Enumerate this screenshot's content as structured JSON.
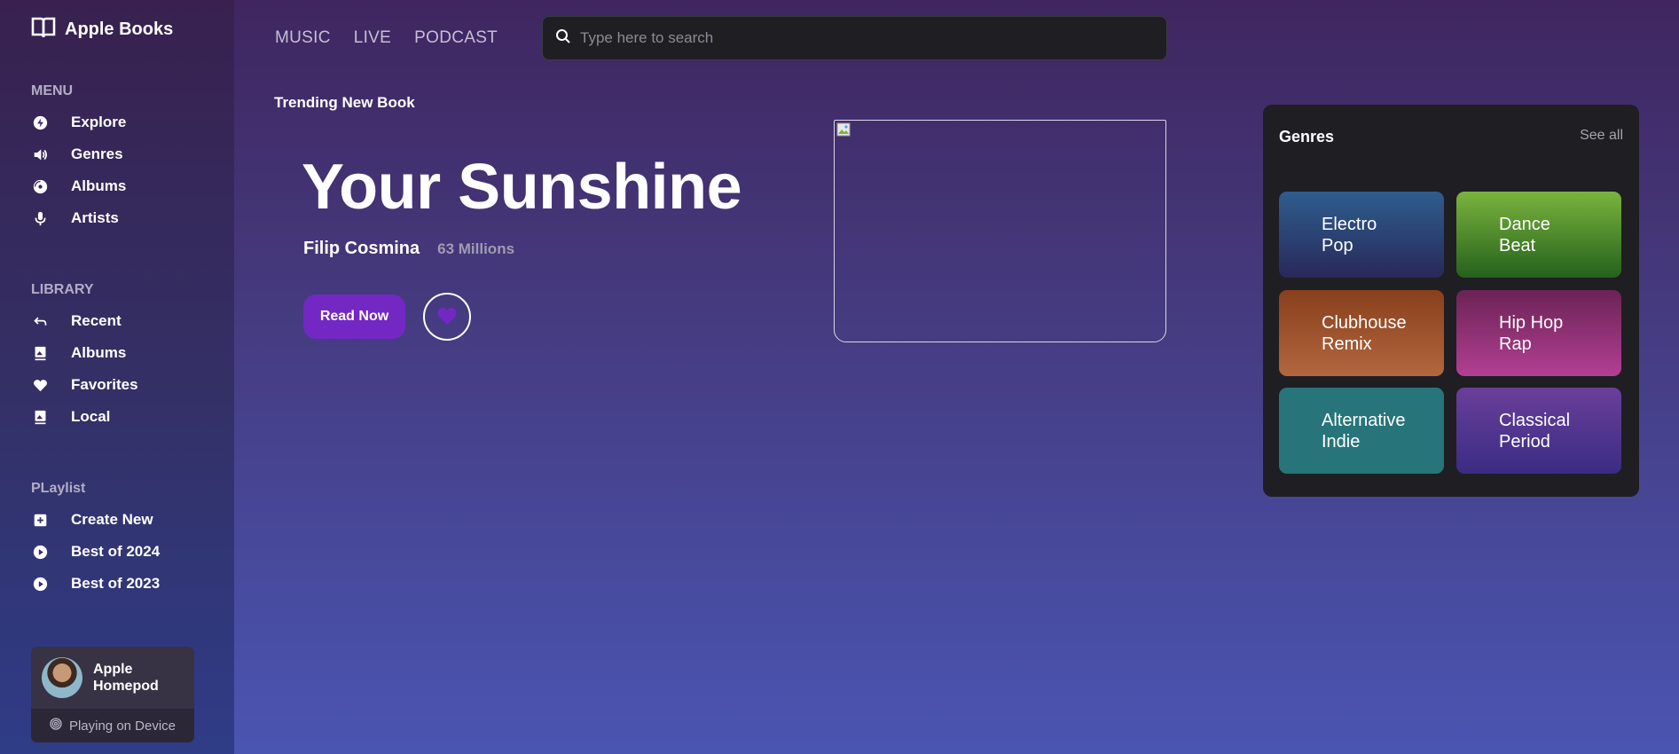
{
  "app": {
    "title": "Apple Books",
    "logo_icon": "open-book-icon"
  },
  "sidebar": {
    "menu": {
      "title": "MENU",
      "items": [
        {
          "label": "Explore",
          "icon": "explore-icon"
        },
        {
          "label": "Genres",
          "icon": "speaker-icon"
        },
        {
          "label": "Albums",
          "icon": "disc-icon"
        },
        {
          "label": "Artists",
          "icon": "microphone-icon"
        }
      ]
    },
    "library": {
      "title": "LIBRARY",
      "items": [
        {
          "label": "Recent",
          "icon": "undo-arrow-icon"
        },
        {
          "label": "Albums",
          "icon": "album-icon"
        },
        {
          "label": "Favorites",
          "icon": "heart-icon"
        },
        {
          "label": "Local",
          "icon": "image-icon"
        }
      ]
    },
    "playlist": {
      "title": "PLaylist",
      "items": [
        {
          "label": "Create New",
          "icon": "plus-square-icon"
        },
        {
          "label": "Best of 2024",
          "icon": "play-circle-icon"
        },
        {
          "label": "Best of 2023",
          "icon": "play-circle-icon"
        }
      ]
    },
    "device": {
      "name": "Apple Homepod",
      "status": "Playing on Device",
      "status_icon": "broadcast-icon"
    }
  },
  "topnav": {
    "items": [
      "MUSIC",
      "LIVE",
      "PODCAST"
    ]
  },
  "search": {
    "placeholder": "Type here to search",
    "value": ""
  },
  "hero": {
    "label": "Trending New Book",
    "title": "Your Sunshine",
    "author": "Filip Cosmina",
    "readers": "63 Millions",
    "primary_button": "Read Now",
    "accent": "#7328c4"
  },
  "genres": {
    "title": "Genres",
    "see_all": "See all",
    "items": [
      {
        "label": "Electro Pop"
      },
      {
        "label": "Dance Beat"
      },
      {
        "label": "Clubhouse Remix"
      },
      {
        "label": "Hip Hop Rap"
      },
      {
        "label": "Alternative Indie"
      },
      {
        "label": "Classical Period"
      }
    ]
  }
}
